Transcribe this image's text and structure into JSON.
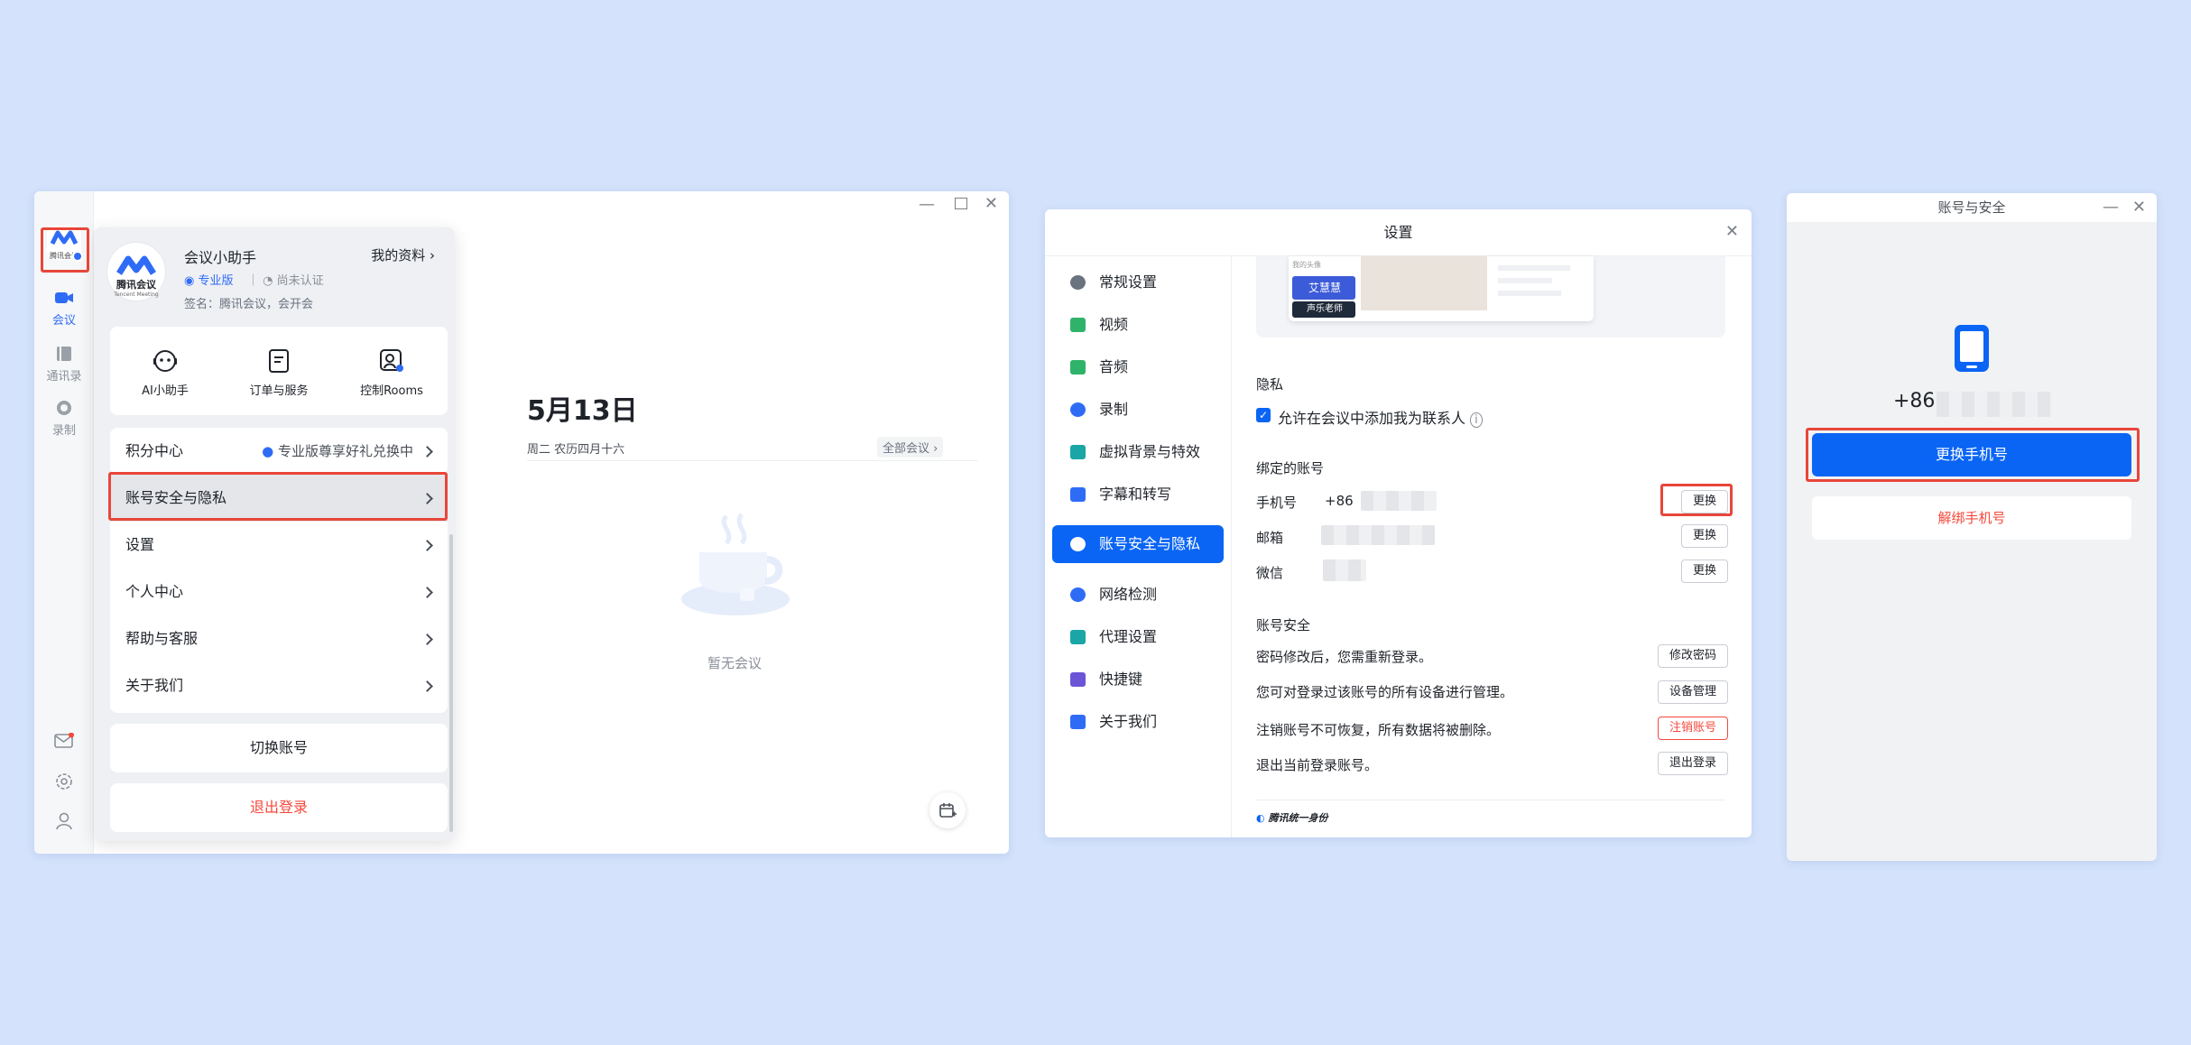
{
  "w1": {
    "rail": {
      "logo": "腾讯会议",
      "meeting": "会议",
      "contacts": "通讯录",
      "record": "录制"
    },
    "profile": {
      "name": "会议小助手",
      "my_profile": "我的资料",
      "logo_cn": "腾讯会议",
      "logo_en": "Tencent Meeting",
      "badge_pro": "专业版",
      "badge_verify": "尚未认证",
      "signature": "签名：腾讯会议，会开会"
    },
    "shortcuts": [
      "AI小助手",
      "订单与服务",
      "控制Rooms"
    ],
    "points": {
      "label": "积分中心",
      "promo": "专业版尊享好礼兑换中"
    },
    "menu": [
      "账号安全与隐私",
      "设置",
      "个人中心",
      "帮助与客服",
      "关于我们"
    ],
    "switch_account": "切换账号",
    "logout": "退出登录",
    "main": {
      "date": "5月13日",
      "sub": "周二 农历四月十六",
      "all_meetings": "全部会议",
      "empty": "暂无会议"
    }
  },
  "w2": {
    "title": "设置",
    "nav": [
      {
        "label": "常规设置",
        "icon": "gear-icon",
        "color": "#6b7280"
      },
      {
        "label": "视频",
        "icon": "video-icon",
        "color": "#2fb36a"
      },
      {
        "label": "音频",
        "icon": "speaker-icon",
        "color": "#2fb36a"
      },
      {
        "label": "录制",
        "icon": "record-icon",
        "color": "#2f6cf6"
      },
      {
        "label": "虚拟背景与特效",
        "icon": "background-icon",
        "color": "#1aa6a6"
      },
      {
        "label": "字幕和转写",
        "icon": "caption-icon",
        "color": "#2f6cf6"
      },
      {
        "label": "账号安全与隐私",
        "icon": "account-icon",
        "color": "#ffffff"
      },
      {
        "label": "网络检测",
        "icon": "globe-icon",
        "color": "#2f6cf6"
      },
      {
        "label": "代理设置",
        "icon": "proxy-icon",
        "color": "#1aa6a6"
      },
      {
        "label": "快捷键",
        "icon": "keyboard-icon",
        "color": "#6b55d6"
      },
      {
        "label": "关于我们",
        "icon": "logo-icon",
        "color": "#2f6cf6"
      }
    ],
    "preview": {
      "name": "艾慧慧",
      "role": "声乐老师",
      "tag": "我的头像"
    },
    "privacy": {
      "title": "隐私",
      "checkbox": "允许在会议中添加我为联系人"
    },
    "bound": {
      "title": "绑定的账号",
      "phone_label": "手机号",
      "phone_prefix": "+86",
      "email_label": "邮箱",
      "wechat_label": "微信",
      "change": "更换"
    },
    "security": {
      "title": "账号安全",
      "rows": [
        {
          "text": "密码修改后，您需重新登录。",
          "btn": "修改密码"
        },
        {
          "text": "您可对登录过该账号的所有设备进行管理。",
          "btn": "设备管理"
        },
        {
          "text": "注销账号不可恢复，所有数据将被删除。",
          "btn": "注销账号"
        },
        {
          "text": "退出当前登录账号。",
          "btn": "退出登录"
        }
      ]
    },
    "footer": "腾讯统一身份"
  },
  "w3": {
    "title": "账号与安全",
    "phone_prefix": "+86",
    "change_phone": "更换手机号",
    "unbind_phone": "解绑手机号"
  },
  "colors": {
    "primary": "#0a65f5",
    "danger": "#f5483b",
    "highlight": "#e8463a"
  }
}
